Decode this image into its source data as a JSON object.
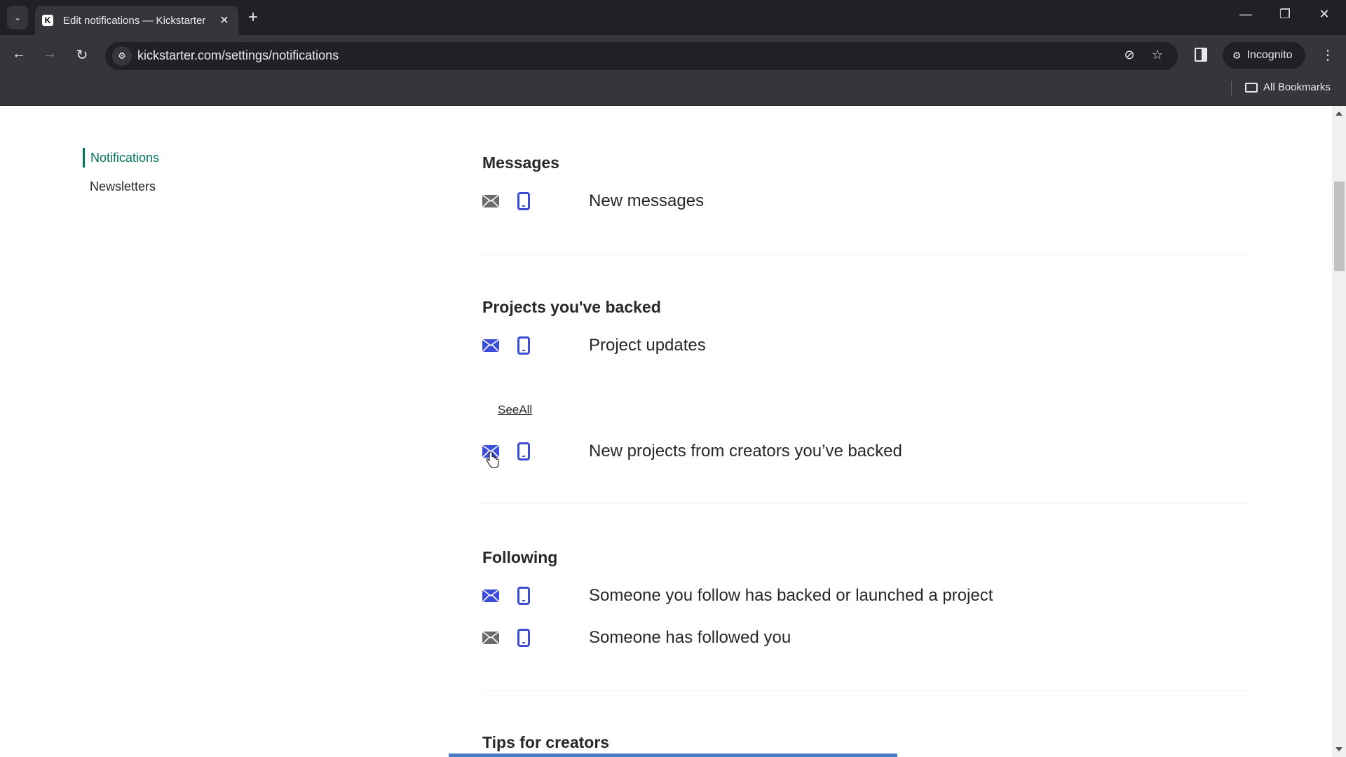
{
  "browser": {
    "tab_title": "Edit notifications — Kickstarter",
    "url": "kickstarter.com/settings/notifications",
    "incognito_label": "Incognito",
    "bookmarks_label": "All Bookmarks",
    "icons": {
      "tab_search": "chevron-down-icon",
      "favicon": "kickstarter-k-icon",
      "close_tab": "close-icon",
      "new_tab": "plus-icon",
      "back": "arrow-left-icon",
      "forward": "arrow-right-icon",
      "reload": "reload-icon",
      "site_info": "tune-icon",
      "tracking": "eye-off-icon",
      "bookmark": "star-icon",
      "side_panel": "side-panel-icon",
      "incognito": "incognito-icon",
      "menu": "kebab-menu-icon",
      "minimize": "minimize-icon",
      "restore": "restore-icon",
      "close_window": "close-icon"
    },
    "glyphs": {
      "tab_search": "⌄",
      "close_tab": "✕",
      "new_tab": "+",
      "back": "←",
      "forward": "→",
      "reload": "↻",
      "site_info": "⚙",
      "tracking": "⊘",
      "bookmark": "☆",
      "menu": "⋮",
      "minimize": "—",
      "restore": "❐",
      "close_window": "✕",
      "incognito": "🕶"
    }
  },
  "sidenav": {
    "items": [
      {
        "label": "Notifications",
        "active": true
      },
      {
        "label": "Newsletters",
        "active": false
      }
    ]
  },
  "colors": {
    "accent_green": "#037362",
    "icon_blue": "#3d4ed6",
    "icon_gray": "#6a6a6a",
    "text": "#282828"
  },
  "sections": [
    {
      "title": "Messages",
      "rows": [
        {
          "label": "New messages",
          "email_on": false,
          "mobile_on": true
        }
      ]
    },
    {
      "title": "Projects you've backed",
      "rows": [
        {
          "label": "Project updates",
          "email_on": true,
          "mobile_on": true
        },
        {
          "label": "New projects from creators you’ve backed",
          "email_on": true,
          "mobile_on": true
        }
      ],
      "see_all_label": "SeeAll"
    },
    {
      "title": "Following",
      "rows": [
        {
          "label": "Someone you follow has backed or launched a project",
          "email_on": true,
          "mobile_on": true
        },
        {
          "label": "Someone has followed you",
          "email_on": false,
          "mobile_on": true
        }
      ]
    },
    {
      "title": "Tips for creators",
      "rows": []
    }
  ]
}
